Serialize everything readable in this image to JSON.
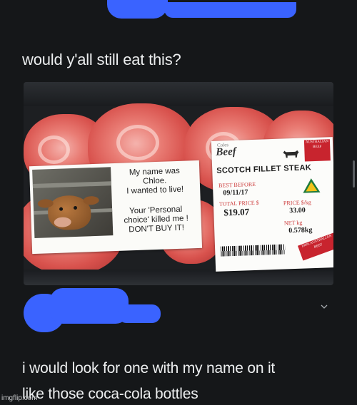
{
  "post": {
    "text": "would y'all still eat this?"
  },
  "photo": {
    "sticker": {
      "message_line1": "My name was",
      "message_line2": "Chloe.",
      "message_line3": "I wanted to live!",
      "message_line4": "Your 'Personal",
      "message_line5": "choice' killed me !",
      "message_line6": "DON'T BUY IT!"
    },
    "label": {
      "brand_small": "Coles",
      "brand": "Beef",
      "flag_text": "AUSTRALIAN BEEF",
      "product": "SCOTCH FILLET STEAK",
      "best_before_label": "BEST BEFORE",
      "best_before": "09/11/17",
      "total_price_label": "TOTAL PRICE $",
      "total_price": "$19.07",
      "price_per_kg_label": "PRICE $/kg",
      "price_per_kg": "33.00",
      "net_label": "NET kg",
      "net": "0.578kg",
      "ribbon_text": "100% AUSTRALIAN BEEF"
    }
  },
  "reply": {
    "text_line1": "i would look for one with my name on it",
    "text_line2": "like those coca-cola bottles"
  },
  "watermark": "imgflip.com",
  "colors": {
    "background": "#151719",
    "redaction": "#3a63ff"
  }
}
